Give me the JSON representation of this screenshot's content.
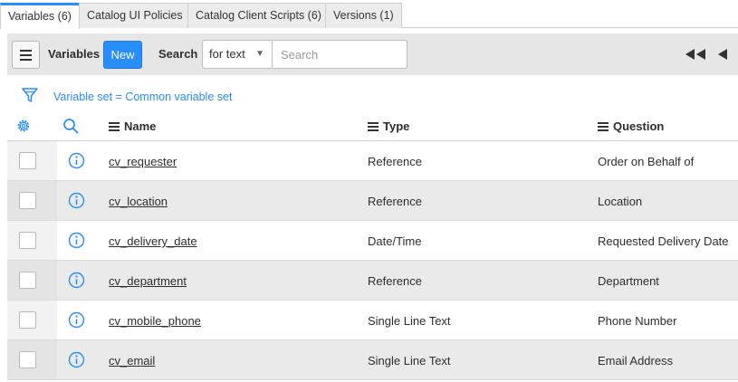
{
  "tabs": [
    {
      "label": "Variables (6)",
      "active": true
    },
    {
      "label": "Catalog UI Policies",
      "active": false
    },
    {
      "label": "Catalog Client Scripts (6)",
      "active": false
    },
    {
      "label": "Versions (1)",
      "active": false
    }
  ],
  "toolbar": {
    "title": "Variables",
    "new_label": "New",
    "search_label": "Search",
    "search_field": "for text",
    "search_placeholder": "Search"
  },
  "filter": {
    "breadcrumb": "Variable set = Common variable set"
  },
  "columns": {
    "name": "Name",
    "type": "Type",
    "question": "Question"
  },
  "rows": [
    {
      "name": "cv_requester",
      "type": "Reference",
      "question": "Order on Behalf of"
    },
    {
      "name": "cv_location",
      "type": "Reference",
      "question": "Location"
    },
    {
      "name": "cv_delivery_date",
      "type": "Date/Time",
      "question": "Requested Delivery Date"
    },
    {
      "name": "cv_department",
      "type": "Reference",
      "question": "Department"
    },
    {
      "name": "cv_mobile_phone",
      "type": "Single Line Text",
      "question": "Phone Number"
    },
    {
      "name": "cv_email",
      "type": "Single Line Text",
      "question": "Email Address"
    }
  ],
  "colors": {
    "accent": "#278efc",
    "toolbar_bg": "#e6e6e6",
    "alt_row_bg": "#eaeaea"
  },
  "icons": {
    "menu": "hamburger-icon",
    "first_page": "double-left-arrow-icon",
    "prev_page": "left-arrow-icon",
    "filter": "funnel-icon",
    "personalize": "gear-icon",
    "search": "magnifier-icon",
    "row_info": "info-circle-icon"
  }
}
